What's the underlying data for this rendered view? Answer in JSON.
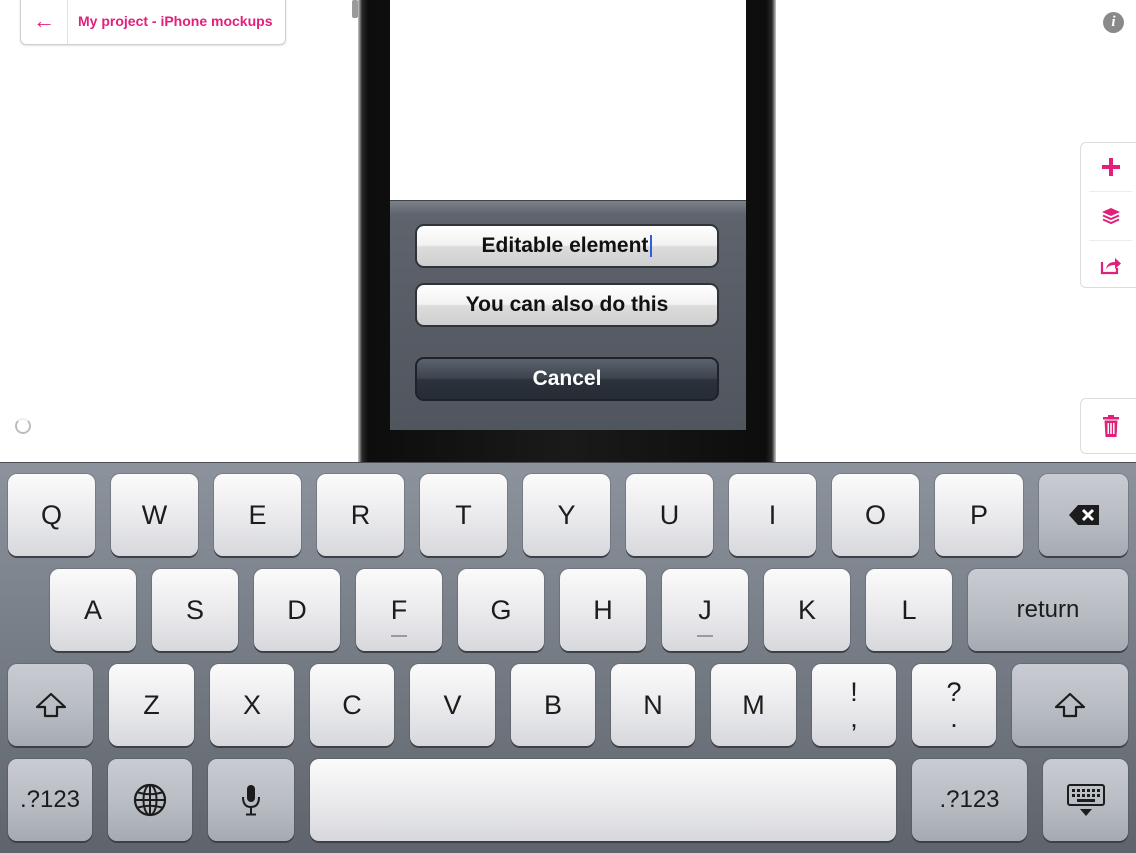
{
  "header": {
    "back_arrow": "←",
    "project_title": "My project - iPhone mockups"
  },
  "info_icon_glyph": "i",
  "toolbar": {
    "icons": [
      "plus-icon",
      "layers-icon",
      "share-icon"
    ],
    "trash_icon": "trash-icon"
  },
  "accent_color": "#e0207a",
  "action_sheet": {
    "editable_label": "Editable element",
    "also_label": "You can also do this",
    "cancel_label": "Cancel"
  },
  "keyboard": {
    "row1": [
      "Q",
      "W",
      "E",
      "R",
      "T",
      "Y",
      "U",
      "I",
      "O",
      "P"
    ],
    "row2": [
      "A",
      "S",
      "D",
      "F",
      "G",
      "H",
      "J",
      "K",
      "L"
    ],
    "return_label": "return",
    "row3": [
      "Z",
      "X",
      "C",
      "V",
      "B",
      "N",
      "M"
    ],
    "excl_top": "!",
    "excl_bottom": ",",
    "question_top": "?",
    "question_bottom": ".",
    "numbers_label_left": ".?123",
    "numbers_label_right": ".?123"
  }
}
